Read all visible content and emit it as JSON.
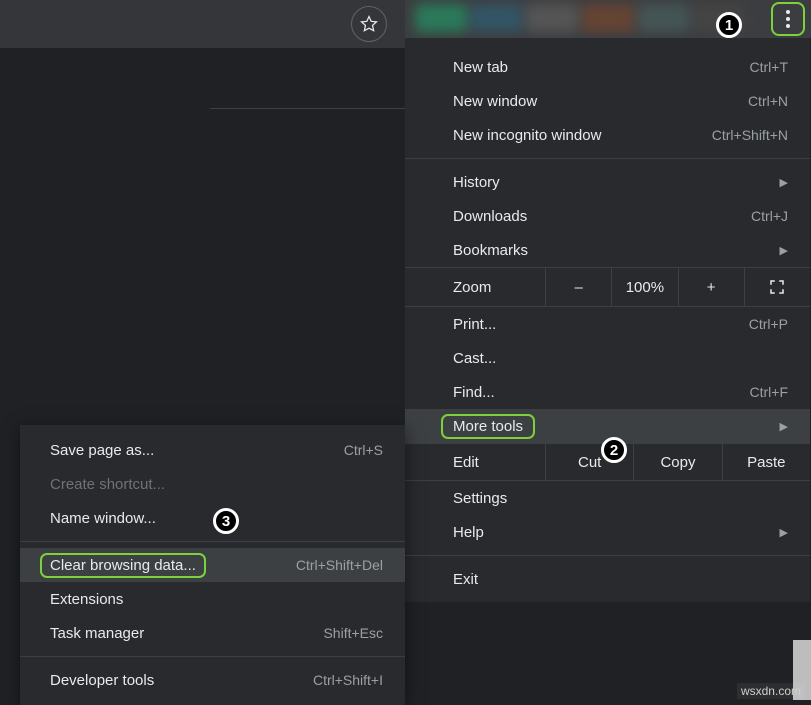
{
  "toolbar": {
    "star_tooltip": "Bookmark this page"
  },
  "menu": {
    "new_tab": {
      "label": "New tab",
      "shortcut": "Ctrl+T"
    },
    "new_window": {
      "label": "New window",
      "shortcut": "Ctrl+N"
    },
    "incognito": {
      "label": "New incognito window",
      "shortcut": "Ctrl+Shift+N"
    },
    "history": {
      "label": "History"
    },
    "downloads": {
      "label": "Downloads",
      "shortcut": "Ctrl+J"
    },
    "bookmarks": {
      "label": "Bookmarks"
    },
    "zoom": {
      "label": "Zoom",
      "value": "100%",
      "minus": "–",
      "plus": "+"
    },
    "print": {
      "label": "Print...",
      "shortcut": "Ctrl+P"
    },
    "cast": {
      "label": "Cast..."
    },
    "find": {
      "label": "Find...",
      "shortcut": "Ctrl+F"
    },
    "more_tools": {
      "label": "More tools"
    },
    "edit": {
      "label": "Edit",
      "cut": "Cut",
      "copy": "Copy",
      "paste": "Paste"
    },
    "settings": {
      "label": "Settings"
    },
    "help": {
      "label": "Help"
    },
    "exit": {
      "label": "Exit"
    }
  },
  "submenu": {
    "save_page": {
      "label": "Save page as...",
      "shortcut": "Ctrl+S"
    },
    "create_shortcut": {
      "label": "Create shortcut..."
    },
    "name_window": {
      "label": "Name window..."
    },
    "clear_data": {
      "label": "Clear browsing data...",
      "shortcut": "Ctrl+Shift+Del"
    },
    "extensions": {
      "label": "Extensions"
    },
    "task_manager": {
      "label": "Task manager",
      "shortcut": "Shift+Esc"
    },
    "dev_tools": {
      "label": "Developer tools",
      "shortcut": "Ctrl+Shift+I"
    }
  },
  "badges": {
    "b1": "1",
    "b2": "2",
    "b3": "3"
  },
  "watermark": "wsxdn.com"
}
